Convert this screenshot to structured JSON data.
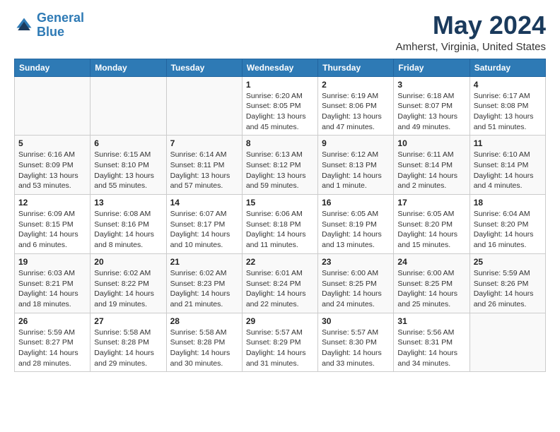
{
  "header": {
    "logo_line1": "General",
    "logo_line2": "Blue",
    "month_year": "May 2024",
    "location": "Amherst, Virginia, United States"
  },
  "weekdays": [
    "Sunday",
    "Monday",
    "Tuesday",
    "Wednesday",
    "Thursday",
    "Friday",
    "Saturday"
  ],
  "weeks": [
    [
      {
        "day": "",
        "sunrise": "",
        "sunset": "",
        "daylight": ""
      },
      {
        "day": "",
        "sunrise": "",
        "sunset": "",
        "daylight": ""
      },
      {
        "day": "",
        "sunrise": "",
        "sunset": "",
        "daylight": ""
      },
      {
        "day": "1",
        "sunrise": "Sunrise: 6:20 AM",
        "sunset": "Sunset: 8:05 PM",
        "daylight": "Daylight: 13 hours and 45 minutes."
      },
      {
        "day": "2",
        "sunrise": "Sunrise: 6:19 AM",
        "sunset": "Sunset: 8:06 PM",
        "daylight": "Daylight: 13 hours and 47 minutes."
      },
      {
        "day": "3",
        "sunrise": "Sunrise: 6:18 AM",
        "sunset": "Sunset: 8:07 PM",
        "daylight": "Daylight: 13 hours and 49 minutes."
      },
      {
        "day": "4",
        "sunrise": "Sunrise: 6:17 AM",
        "sunset": "Sunset: 8:08 PM",
        "daylight": "Daylight: 13 hours and 51 minutes."
      }
    ],
    [
      {
        "day": "5",
        "sunrise": "Sunrise: 6:16 AM",
        "sunset": "Sunset: 8:09 PM",
        "daylight": "Daylight: 13 hours and 53 minutes."
      },
      {
        "day": "6",
        "sunrise": "Sunrise: 6:15 AM",
        "sunset": "Sunset: 8:10 PM",
        "daylight": "Daylight: 13 hours and 55 minutes."
      },
      {
        "day": "7",
        "sunrise": "Sunrise: 6:14 AM",
        "sunset": "Sunset: 8:11 PM",
        "daylight": "Daylight: 13 hours and 57 minutes."
      },
      {
        "day": "8",
        "sunrise": "Sunrise: 6:13 AM",
        "sunset": "Sunset: 8:12 PM",
        "daylight": "Daylight: 13 hours and 59 minutes."
      },
      {
        "day": "9",
        "sunrise": "Sunrise: 6:12 AM",
        "sunset": "Sunset: 8:13 PM",
        "daylight": "Daylight: 14 hours and 1 minute."
      },
      {
        "day": "10",
        "sunrise": "Sunrise: 6:11 AM",
        "sunset": "Sunset: 8:14 PM",
        "daylight": "Daylight: 14 hours and 2 minutes."
      },
      {
        "day": "11",
        "sunrise": "Sunrise: 6:10 AM",
        "sunset": "Sunset: 8:14 PM",
        "daylight": "Daylight: 14 hours and 4 minutes."
      }
    ],
    [
      {
        "day": "12",
        "sunrise": "Sunrise: 6:09 AM",
        "sunset": "Sunset: 8:15 PM",
        "daylight": "Daylight: 14 hours and 6 minutes."
      },
      {
        "day": "13",
        "sunrise": "Sunrise: 6:08 AM",
        "sunset": "Sunset: 8:16 PM",
        "daylight": "Daylight: 14 hours and 8 minutes."
      },
      {
        "day": "14",
        "sunrise": "Sunrise: 6:07 AM",
        "sunset": "Sunset: 8:17 PM",
        "daylight": "Daylight: 14 hours and 10 minutes."
      },
      {
        "day": "15",
        "sunrise": "Sunrise: 6:06 AM",
        "sunset": "Sunset: 8:18 PM",
        "daylight": "Daylight: 14 hours and 11 minutes."
      },
      {
        "day": "16",
        "sunrise": "Sunrise: 6:05 AM",
        "sunset": "Sunset: 8:19 PM",
        "daylight": "Daylight: 14 hours and 13 minutes."
      },
      {
        "day": "17",
        "sunrise": "Sunrise: 6:05 AM",
        "sunset": "Sunset: 8:20 PM",
        "daylight": "Daylight: 14 hours and 15 minutes."
      },
      {
        "day": "18",
        "sunrise": "Sunrise: 6:04 AM",
        "sunset": "Sunset: 8:20 PM",
        "daylight": "Daylight: 14 hours and 16 minutes."
      }
    ],
    [
      {
        "day": "19",
        "sunrise": "Sunrise: 6:03 AM",
        "sunset": "Sunset: 8:21 PM",
        "daylight": "Daylight: 14 hours and 18 minutes."
      },
      {
        "day": "20",
        "sunrise": "Sunrise: 6:02 AM",
        "sunset": "Sunset: 8:22 PM",
        "daylight": "Daylight: 14 hours and 19 minutes."
      },
      {
        "day": "21",
        "sunrise": "Sunrise: 6:02 AM",
        "sunset": "Sunset: 8:23 PM",
        "daylight": "Daylight: 14 hours and 21 minutes."
      },
      {
        "day": "22",
        "sunrise": "Sunrise: 6:01 AM",
        "sunset": "Sunset: 8:24 PM",
        "daylight": "Daylight: 14 hours and 22 minutes."
      },
      {
        "day": "23",
        "sunrise": "Sunrise: 6:00 AM",
        "sunset": "Sunset: 8:25 PM",
        "daylight": "Daylight: 14 hours and 24 minutes."
      },
      {
        "day": "24",
        "sunrise": "Sunrise: 6:00 AM",
        "sunset": "Sunset: 8:25 PM",
        "daylight": "Daylight: 14 hours and 25 minutes."
      },
      {
        "day": "25",
        "sunrise": "Sunrise: 5:59 AM",
        "sunset": "Sunset: 8:26 PM",
        "daylight": "Daylight: 14 hours and 26 minutes."
      }
    ],
    [
      {
        "day": "26",
        "sunrise": "Sunrise: 5:59 AM",
        "sunset": "Sunset: 8:27 PM",
        "daylight": "Daylight: 14 hours and 28 minutes."
      },
      {
        "day": "27",
        "sunrise": "Sunrise: 5:58 AM",
        "sunset": "Sunset: 8:28 PM",
        "daylight": "Daylight: 14 hours and 29 minutes."
      },
      {
        "day": "28",
        "sunrise": "Sunrise: 5:58 AM",
        "sunset": "Sunset: 8:28 PM",
        "daylight": "Daylight: 14 hours and 30 minutes."
      },
      {
        "day": "29",
        "sunrise": "Sunrise: 5:57 AM",
        "sunset": "Sunset: 8:29 PM",
        "daylight": "Daylight: 14 hours and 31 minutes."
      },
      {
        "day": "30",
        "sunrise": "Sunrise: 5:57 AM",
        "sunset": "Sunset: 8:30 PM",
        "daylight": "Daylight: 14 hours and 33 minutes."
      },
      {
        "day": "31",
        "sunrise": "Sunrise: 5:56 AM",
        "sunset": "Sunset: 8:31 PM",
        "daylight": "Daylight: 14 hours and 34 minutes."
      },
      {
        "day": "",
        "sunrise": "",
        "sunset": "",
        "daylight": ""
      }
    ]
  ]
}
